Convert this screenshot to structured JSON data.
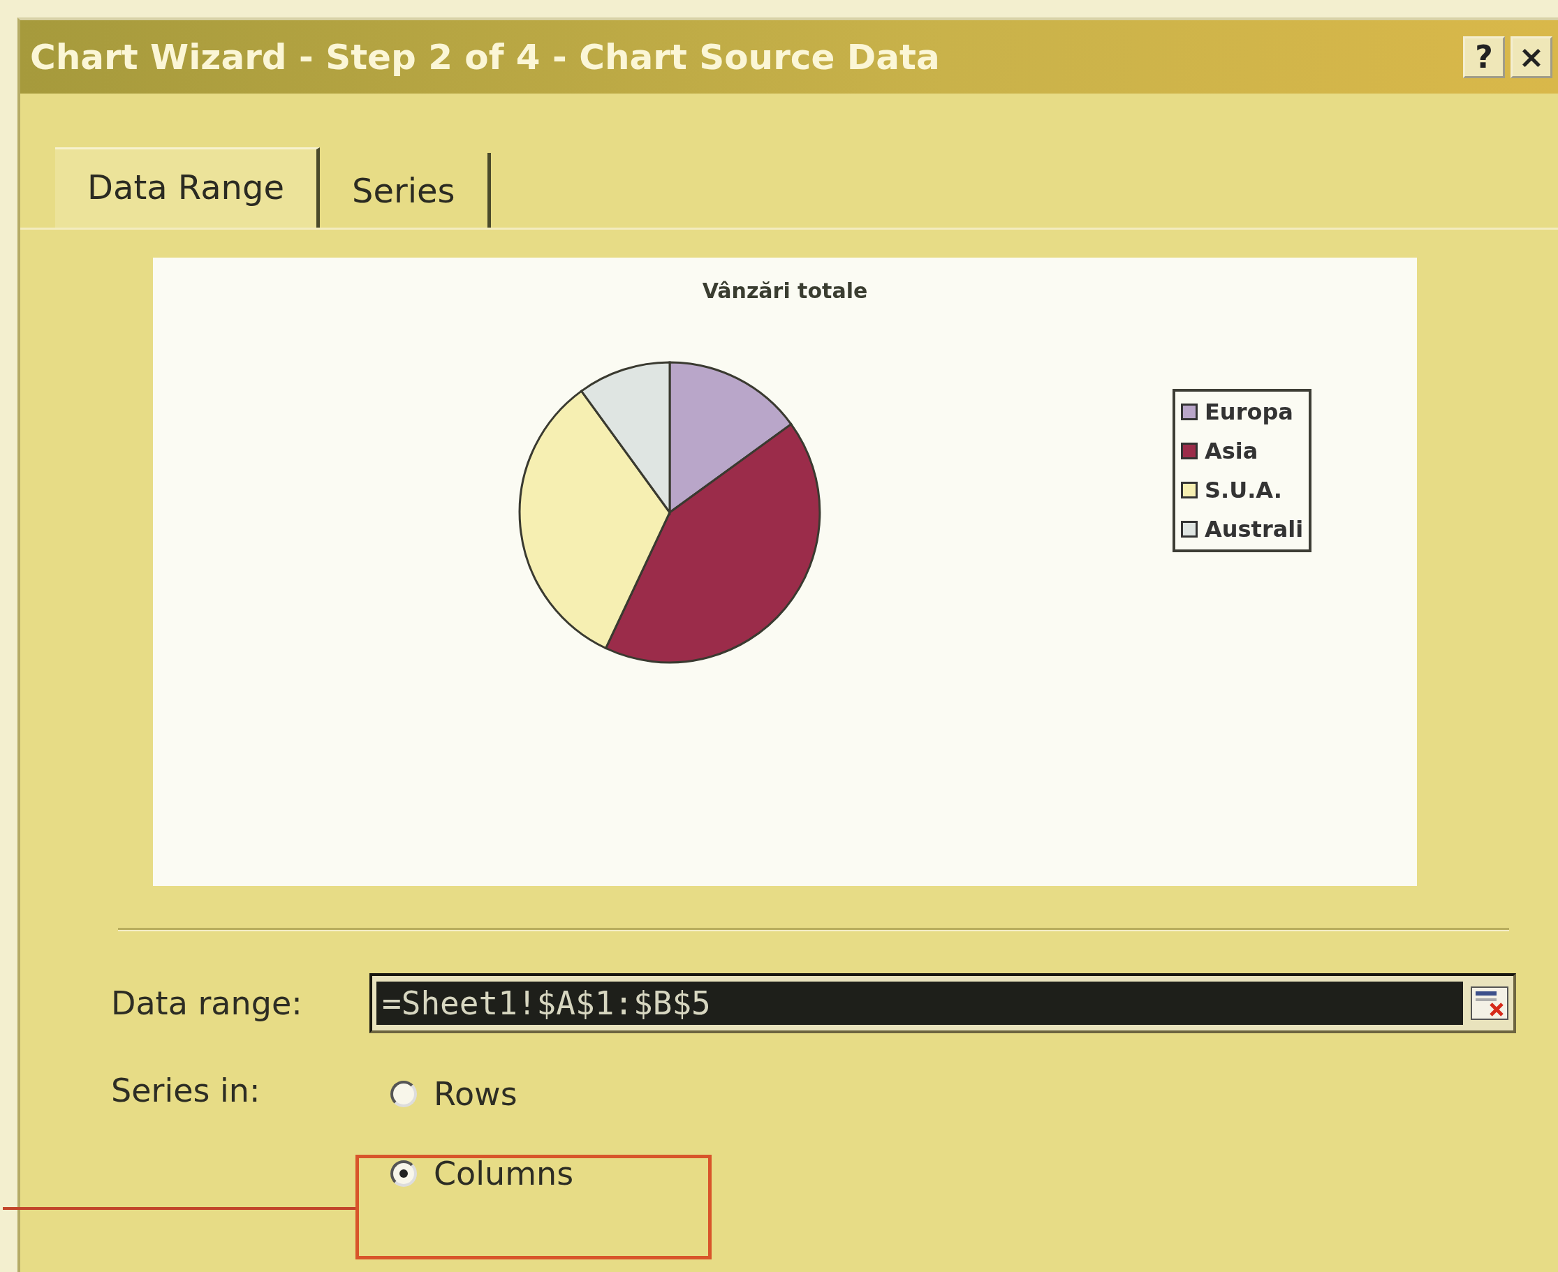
{
  "window": {
    "title": "Chart Wizard - Step 2 of 4 - Chart Source Data",
    "help_button": "?",
    "close_button": "×"
  },
  "tabs": [
    {
      "label": "Data Range",
      "selected": true
    },
    {
      "label": "Series",
      "selected": false
    }
  ],
  "preview": {
    "title": "Vânzări totale",
    "legend": [
      {
        "label": "Europa",
        "color": "#b9a6c9"
      },
      {
        "label": "Asia",
        "color": "#9b2c4a"
      },
      {
        "label": "S.U.A.",
        "color": "#f6efb2"
      },
      {
        "label": "Australi",
        "color": "#dfe5e2"
      }
    ]
  },
  "data_range": {
    "label": "Data range:",
    "value": "=Sheet1!$A$1:$B$5"
  },
  "series_in": {
    "label": "Series in:",
    "options": [
      {
        "label": "Rows",
        "selected": false
      },
      {
        "label": "Columns",
        "selected": true
      }
    ]
  }
}
